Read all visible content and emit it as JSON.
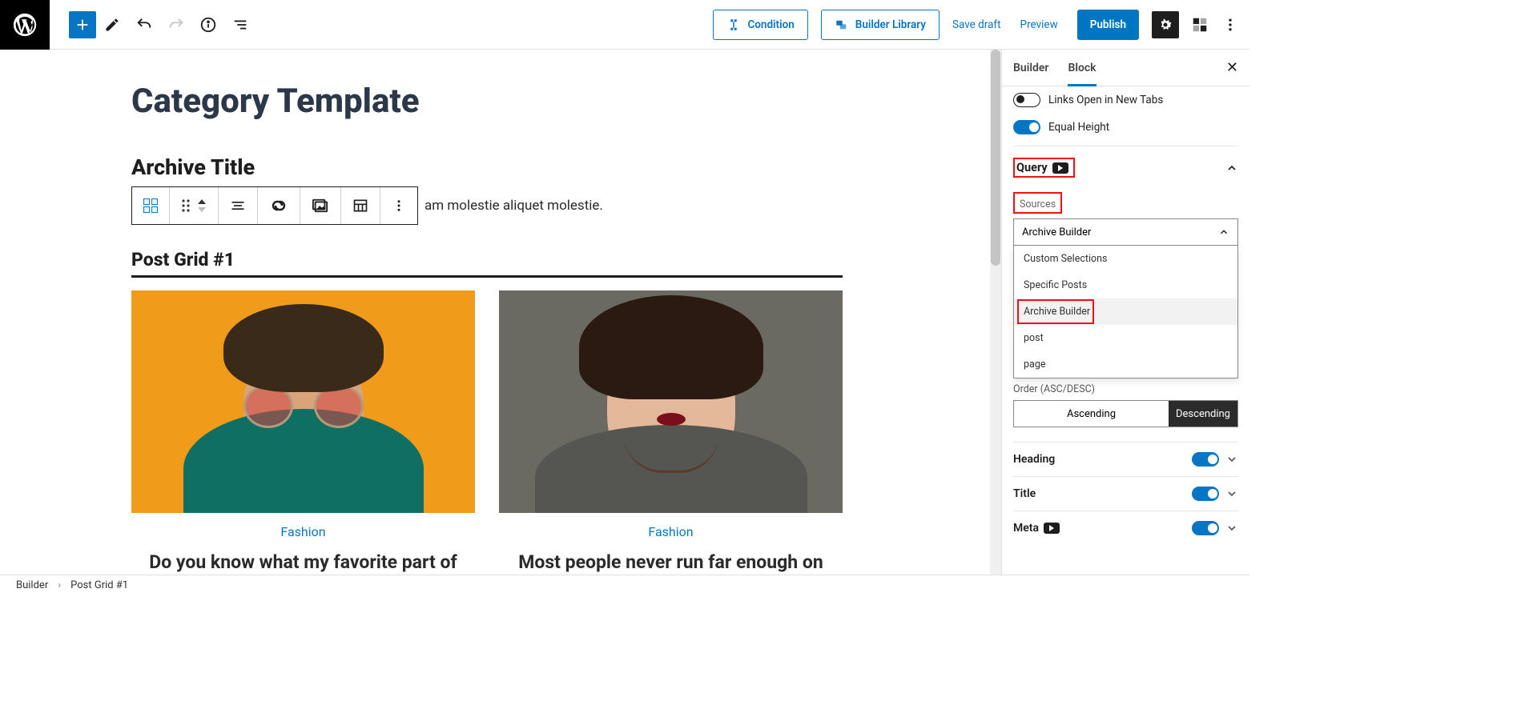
{
  "topbar": {
    "condition": "Condition",
    "library": "Builder Library",
    "save_draft": "Save draft",
    "preview": "Preview",
    "publish": "Publish"
  },
  "canvas": {
    "page_title": "Category Template",
    "archive_title": "Archive Title",
    "paragraph_tail": "am molestie aliquet molestie.",
    "grid_heading": "Post Grid #1",
    "posts": [
      {
        "category": "Fashion",
        "title": "Do you know what my favorite part of"
      },
      {
        "category": "Fashion",
        "title": "Most people never run far enough on"
      }
    ]
  },
  "sidebar": {
    "tabs": {
      "builder": "Builder",
      "block": "Block"
    },
    "links_open": "Links Open in New Tabs",
    "equal_height": "Equal Height",
    "query_label": "Query",
    "sources_label": "Sources",
    "sources_selected": "Archive Builder",
    "sources_options": {
      "o1": "Custom Selections",
      "o2": "Specific Posts",
      "o3": "Archive Builder",
      "o4": "post",
      "o5": "page"
    },
    "order_label": "Order (ASC/DESC)",
    "order_asc": "Ascending",
    "order_desc": "Descending",
    "heading": "Heading",
    "title": "Title",
    "meta": "Meta"
  },
  "breadcrumb": {
    "a": "Builder",
    "b": "Post Grid #1"
  }
}
